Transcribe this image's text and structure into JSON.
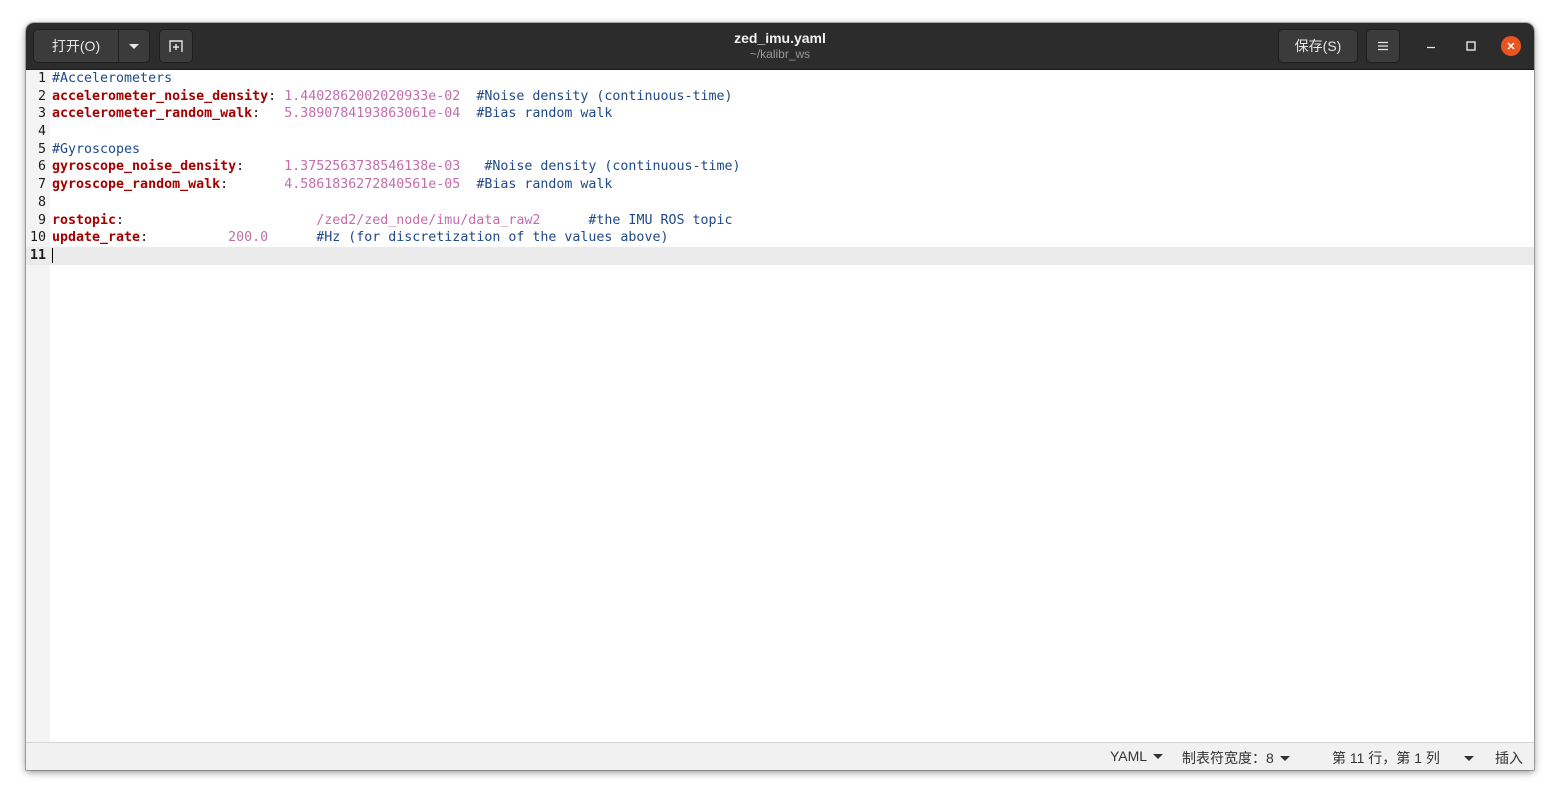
{
  "window": {
    "title": "zed_imu.yaml",
    "subtitle": "~/kalibr_ws"
  },
  "headerbar": {
    "open_label": "打开(O)",
    "save_label": "保存(S)"
  },
  "editor": {
    "lines": [
      {
        "num": "1",
        "comment": "#Accelerometers"
      },
      {
        "num": "2",
        "key": "accelerometer_noise_density",
        "colon": ":",
        "gap1": " ",
        "value": "1.4402862002020933e-02",
        "gap2": "  ",
        "comment": "#Noise density (continuous-time)"
      },
      {
        "num": "3",
        "key": "accelerometer_random_walk",
        "colon": ":",
        "gap1": "   ",
        "value": "5.3890784193863061e-04",
        "gap2": "  ",
        "comment": "#Bias random walk"
      },
      {
        "num": "4"
      },
      {
        "num": "5",
        "comment": "#Gyroscopes"
      },
      {
        "num": "6",
        "key": "gyroscope_noise_density",
        "colon": ":",
        "gap1": "     ",
        "value": "1.3752563738546138e-03",
        "gap2": "   ",
        "comment": "#Noise density (continuous-time)"
      },
      {
        "num": "7",
        "key": "gyroscope_random_walk",
        "colon": ":",
        "gap1": "       ",
        "value": "4.5861836272840561e-05",
        "gap2": "  ",
        "comment": "#Bias random walk"
      },
      {
        "num": "8"
      },
      {
        "num": "9",
        "key": "rostopic",
        "colon": ":",
        "gap1": "                        ",
        "value": "/zed2/zed_node/imu/data_raw2",
        "gap2": "      ",
        "comment": "#the IMU ROS topic"
      },
      {
        "num": "10",
        "key": "update_rate",
        "colon": ":",
        "gap1": "          ",
        "value": "200.0",
        "gap2": "      ",
        "comment": "#Hz (for discretization of the values above)"
      },
      {
        "num": "11",
        "current": true
      }
    ]
  },
  "statusbar": {
    "language": "YAML",
    "tab_width": "制表符宽度：8",
    "position": "第 11 行，第 1 列",
    "mode": "插入"
  },
  "colors": {
    "headerbar": "#2c2c2c",
    "close_button": "#e95420",
    "key": "#a40000",
    "value": "#c36cb0",
    "comment": "#204a87"
  },
  "icons": {
    "open_menu": "chevron-down-icon",
    "new_tab": "new-document-icon",
    "menu": "hamburger-icon",
    "minimize": "minimize-icon",
    "maximize": "maximize-icon",
    "close": "close-icon"
  }
}
